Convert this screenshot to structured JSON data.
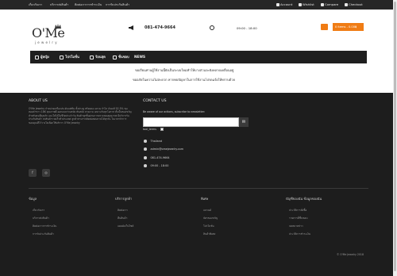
{
  "top_nav": [
    "เกี่ยวกับเรา",
    "บริการส่งสินค้า",
    "ติดต่อเราการชำระเงิน",
    "การรับประกันสินค้า"
  ],
  "top_links": [
    "Account",
    "Wishlist",
    "Compare",
    "Checkout"
  ],
  "header": {
    "logo": "O'Me",
    "logo_sub": "jewelry",
    "phone": "081-474-9664",
    "hours": "09:00 - 18:00",
    "cart": "0 items - 0.00฿"
  },
  "nav": [
    "ผู้หญิง",
    "โปรโมชั่น",
    "ร้อนสุด",
    "ชื่นชอบ",
    "NEWS"
  ],
  "marquee": {
    "line1": "ขอเรียนท่านผู้ใช้งานนี้ยังเป็นระบบใหม่ทำให้บางส่วนจะยังคลาดเคลื่อนอยู่",
    "line2": "ขออภัยในความไม่สะดวก หากพบปัญหาในการใช้งานโปรดแจ้งให้ทราบด้วย"
  },
  "footer": {
    "about_title": "ABOUT US",
    "about_text": "O'Me Jewelry จำหน่ายเครื่องประดับแฟชั่น ทั้งต่างหู สร้อยคอ แหวน กำไล เงินแท้ 92.5% ชุบทองคำขาว 18K คุณภาพดี ออกแบบร่วมสมัย ทันสมัย สวยงาม เหมาะกับทุกโอกาส ทั้งเป็นของขวัญสำหรับคนที่คุณรัก และใส่ได้ในชีวิตประจำวัน สินค้าทุกชิ้นผ่านการตรวจสอบคุณภาพ มีบริการรับประกันสินค้า ส่งสินค้ารวดเร็วทั่วประเทศ ลูกค้าสามารถติดต่อสอบถามได้ทุกวัน ในเวลาทำการ ขอบคุณที่ไว้วางใจเลือกใช้บริการ O'Me Jewelry",
    "social": [
      "f",
      "◎"
    ],
    "contact_title": "CONTACT US",
    "subscribe_label": "Be aware of our actions, subscribe to newsletter:",
    "subscribe_button": "✉",
    "tos_label": "tool_terms",
    "contact_lines": [
      "Thailand",
      "admin@omejewelry.com",
      "081-474-9664",
      "09:00 - 18:00"
    ],
    "columns": [
      {
        "title": "ข้อมูล",
        "links": [
          "เกี่ยวกับเรา",
          "บริการส่งสินค้า",
          "ติดต่อเราการชำระเงิน",
          "การรับประกันสินค้า"
        ]
      },
      {
        "title": "บริการลูกค้า",
        "links": [
          "ติดต่อเรา",
          "คืนสินค้า",
          "แผนผังเว็บไซต์"
        ]
      },
      {
        "title": "พิเศษ",
        "links": [
          "แบรนด์",
          "บัตรของขวัญ",
          "โปรโมชั่น",
          "สินค้าพิเศษ"
        ]
      },
      {
        "title": "บัญชีของฉัน ข้อมูลของฉัน",
        "links": [
          "ประวัติการสั่งซื้อ",
          "รายการที่ชื่นชอบ",
          "จดหมายข่าว",
          "ประวัติการชำระเงิน"
        ]
      }
    ],
    "copyright": "© O'Me Jewelry 2018"
  },
  "colors": {
    "accent": "#f07c14",
    "footer_bg": "#1d1d1d",
    "topbar_bg": "#262626",
    "nav_bg": "#1f1f1f"
  }
}
